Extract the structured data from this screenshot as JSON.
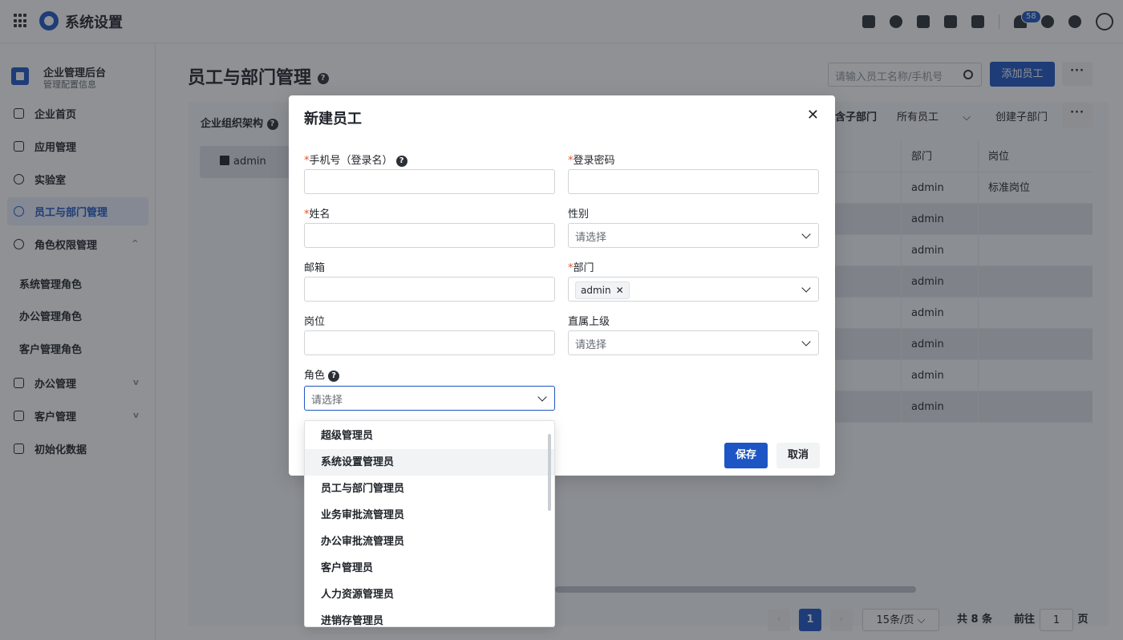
{
  "app": {
    "title": "系统设置",
    "notification_count": "58"
  },
  "sidebar": {
    "org_title": "企业管理后台",
    "org_subtitle": "管理配置信息",
    "items": [
      {
        "label": "企业首页"
      },
      {
        "label": "应用管理"
      },
      {
        "label": "实验室"
      },
      {
        "label": "员工与部门管理"
      },
      {
        "label": "角色权限管理"
      },
      {
        "label": "办公管理"
      },
      {
        "label": "客户管理"
      },
      {
        "label": "初始化数据"
      }
    ],
    "sub_items": [
      {
        "label": "系统管理角色"
      },
      {
        "label": "办公管理角色"
      },
      {
        "label": "客户管理角色"
      }
    ]
  },
  "main": {
    "title": "员工与部门管理",
    "search_placeholder": "请输入员工名称/手机号",
    "add_employee": "添加员工",
    "more": "···",
    "org_structure": "企业组织架构",
    "org_root": "admin",
    "include_sub": "含子部门",
    "employee_filter": "所有员工",
    "create_sub_dept": "创建子部门",
    "table": {
      "headers": [
        "部门",
        "岗位"
      ],
      "rows": [
        {
          "dept": "admin",
          "position": "标准岗位"
        },
        {
          "dept": "admin",
          "position": ""
        },
        {
          "dept": "admin",
          "position": ""
        },
        {
          "dept": "admin",
          "position": ""
        },
        {
          "dept": "admin",
          "position": ""
        },
        {
          "dept": "admin",
          "position": ""
        },
        {
          "dept": "admin",
          "position": ""
        },
        {
          "dept": "admin",
          "position": ""
        }
      ]
    },
    "pagination": {
      "current": "1",
      "page_size": "15条/页",
      "total": "共 8 条",
      "goto_label": "前往",
      "goto_value": "1",
      "page_unit": "页"
    }
  },
  "modal": {
    "title": "新建员工",
    "fields": {
      "phone": {
        "label": "手机号（登录名）",
        "required": "*"
      },
      "password": {
        "label": "登录密码",
        "required": "*"
      },
      "name": {
        "label": "姓名",
        "required": "*"
      },
      "gender": {
        "label": "性别",
        "placeholder": "请选择"
      },
      "email": {
        "label": "邮箱"
      },
      "dept": {
        "label": "部门",
        "required": "*",
        "tag": "admin"
      },
      "position": {
        "label": "岗位"
      },
      "superior": {
        "label": "直属上级",
        "placeholder": "请选择"
      },
      "role": {
        "label": "角色",
        "placeholder": "请选择"
      }
    },
    "save": "保存",
    "cancel": "取消"
  },
  "role_dropdown": {
    "options": [
      "超级管理员",
      "系统设置管理员",
      "员工与部门管理员",
      "业务审批流管理员",
      "办公审批流管理员",
      "客户管理员",
      "人力资源管理员",
      "进销存管理员"
    ],
    "hovered_index": 1
  }
}
